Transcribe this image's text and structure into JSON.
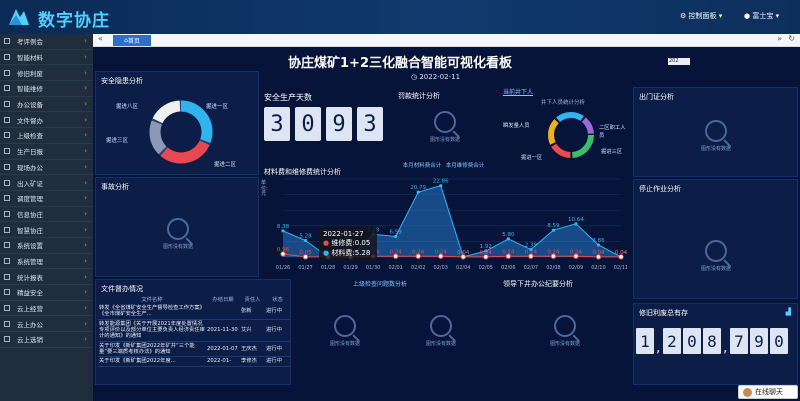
{
  "app": {
    "name": "数字协庄",
    "control_panel": "控制面板",
    "user": "富士宝"
  },
  "sidebar": {
    "items": [
      {
        "label": "考评例会"
      },
      {
        "label": "智能材料"
      },
      {
        "label": "修旧利废"
      },
      {
        "label": "智能维修"
      },
      {
        "label": "办公设备"
      },
      {
        "label": "文件督办"
      },
      {
        "label": "上级检查"
      },
      {
        "label": "生产日报"
      },
      {
        "label": "现场办公"
      },
      {
        "label": "出入矿证"
      },
      {
        "label": "调度管理"
      },
      {
        "label": "信息协庄"
      },
      {
        "label": "智慧协庄"
      },
      {
        "label": "系统设置"
      },
      {
        "label": "系统管理"
      },
      {
        "label": "统计报表"
      },
      {
        "label": "精益安全"
      },
      {
        "label": "云上经营"
      },
      {
        "label": "云上办公"
      },
      {
        "label": "云上选销"
      }
    ]
  },
  "tab": {
    "home": "首页"
  },
  "board": {
    "title": "协庄煤矿1+2三化融合智能可视化看板",
    "date": "2022-02-11",
    "ticker": "202",
    "safety_hazard": {
      "title": "安全隐患分析",
      "labels": [
        "掘进八区",
        "掘进一区",
        "掘进二区",
        "掘进三区"
      ]
    },
    "safe_days": {
      "title": "安全生产天数",
      "digits": [
        "3",
        "0",
        "9",
        "3"
      ]
    },
    "violation": {
      "title": "罚款统计分析"
    },
    "underground": {
      "title": "当前井下人",
      "sub": "井下人员统计分析",
      "labels": [
        "瞬发量人员",
        "二区职工人员",
        "掘进一区",
        "掘进三区"
      ]
    },
    "exit_pass": {
      "title": "出门证分析",
      "nodata": "图形没有数据"
    },
    "accident": {
      "title": "事故分析",
      "nodata": "图形没有数据"
    },
    "stop_work": {
      "title": "停止作业分析",
      "nodata": "图形没有数据"
    },
    "material": {
      "title": "材料费和维修费统计分析",
      "legend1": "本月材料费合计",
      "legend2": "本月维修费合计",
      "ylabel": "单位:元"
    },
    "docs": {
      "title": "文件督办情况",
      "headers": [
        "文件名称",
        "办结日期",
        "责任人",
        "状态"
      ],
      "rows": [
        [
          "转发《全省煤矿安全生产督导检查工作方案》《全市煤矿安全生产...",
          "",
          "张新",
          "进行中"
        ],
        [
          "转发能源集团《关于开展2021年度处置情况专项评价以及部分单位主要负责人经济责任审计的通知》的通知",
          "2021-11-30",
          "艾兴",
          "进行中"
        ],
        [
          "关于印发《新矿集团2022年矿井“三个能量”要三端质考核办法》的通知",
          "2022-01-07",
          "王庆杰",
          "进行中"
        ],
        [
          "关于印发《新矿集团2022年度...",
          "2022-01-",
          "李修杰",
          "进行中"
        ]
      ]
    },
    "upper_check": {
      "title": "上级检查问题数分析",
      "nodata": "图形没有数据"
    },
    "lead_down": {
      "title": "领导下井办公纪要分析",
      "nodata": "图形没有数据"
    },
    "recycle": {
      "title": "修旧利废总有存",
      "digits": [
        "1",
        ",",
        "2",
        "0",
        "8",
        ",",
        "7",
        "9",
        "0"
      ]
    },
    "nodata_left": "图形没有数据",
    "nodata_center": "图形没有数据"
  },
  "tooltip": {
    "date": "2022-01-27",
    "line1": "维修费:0.05",
    "line2": "材料费:5.28"
  },
  "chat": {
    "label": "在线聊天"
  },
  "chart_data": {
    "type": "line",
    "categories": [
      "01/26",
      "01/27",
      "01/28",
      "01/29",
      "01/30",
      "02/01",
      "02/02",
      "02/03",
      "02/04",
      "02/05",
      "02/06",
      "02/07",
      "02/08",
      "02/09",
      "02/10",
      "02/11"
    ],
    "series": [
      {
        "name": "本月材料费合计",
        "values": [
          8.38,
          5.28,
          0.04,
          0.04,
          7.28,
          6.59,
          20.79,
          22.86,
          0.04,
          1.92,
          5.8,
          2.39,
          8.59,
          10.64,
          3.86,
          0.04
        ]
      },
      {
        "name": "本月维修费合计",
        "values": [
          0.96,
          0.05,
          0.04,
          0.04,
          0.24,
          0.24,
          0.24,
          0.24,
          0.04,
          0.04,
          0.24,
          0.24,
          0.24,
          0.24,
          0.04,
          0.04
        ]
      }
    ],
    "ylim": [
      0,
      25
    ],
    "title": "材料费和维修费统计分析",
    "ylabel": "单位:元"
  }
}
